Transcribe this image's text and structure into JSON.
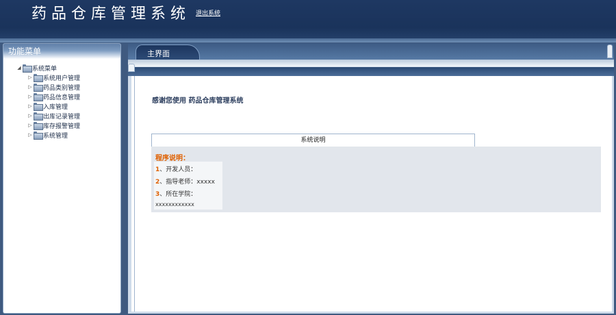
{
  "header": {
    "app_title": "药品仓库管理系统",
    "logout_label": "退出系统"
  },
  "sidebar": {
    "title": "功能菜单",
    "root": {
      "label": "系统菜单",
      "expander": "◢"
    },
    "items": [
      {
        "label": "系统用户管理",
        "expander": "▷"
      },
      {
        "label": "药品类别管理",
        "expander": "▷"
      },
      {
        "label": "药品信息管理",
        "expander": "▷"
      },
      {
        "label": "入库管理",
        "expander": "▷"
      },
      {
        "label": "出库记录管理",
        "expander": "▷"
      },
      {
        "label": "库存报警管理",
        "expander": "▷"
      },
      {
        "label": "系统管理",
        "expander": "▷"
      }
    ]
  },
  "main": {
    "tab_label": "主界面",
    "welcome_text": "感谢您使用 药品仓库管理系统",
    "info": {
      "header": "系统说明",
      "title": "程序说明：",
      "items": [
        {
          "num": "1",
          "text": "、开发人员："
        },
        {
          "num": "2",
          "text": "、指导老师：xxxxx"
        },
        {
          "num": "3",
          "text": "、所在学院："
        }
      ],
      "footer": "xxxxxxxxxxxx"
    }
  },
  "colors": {
    "header_bg": "#1e3862",
    "accent_orange": "#e06000",
    "panel_gray": "#e2e6ec"
  }
}
